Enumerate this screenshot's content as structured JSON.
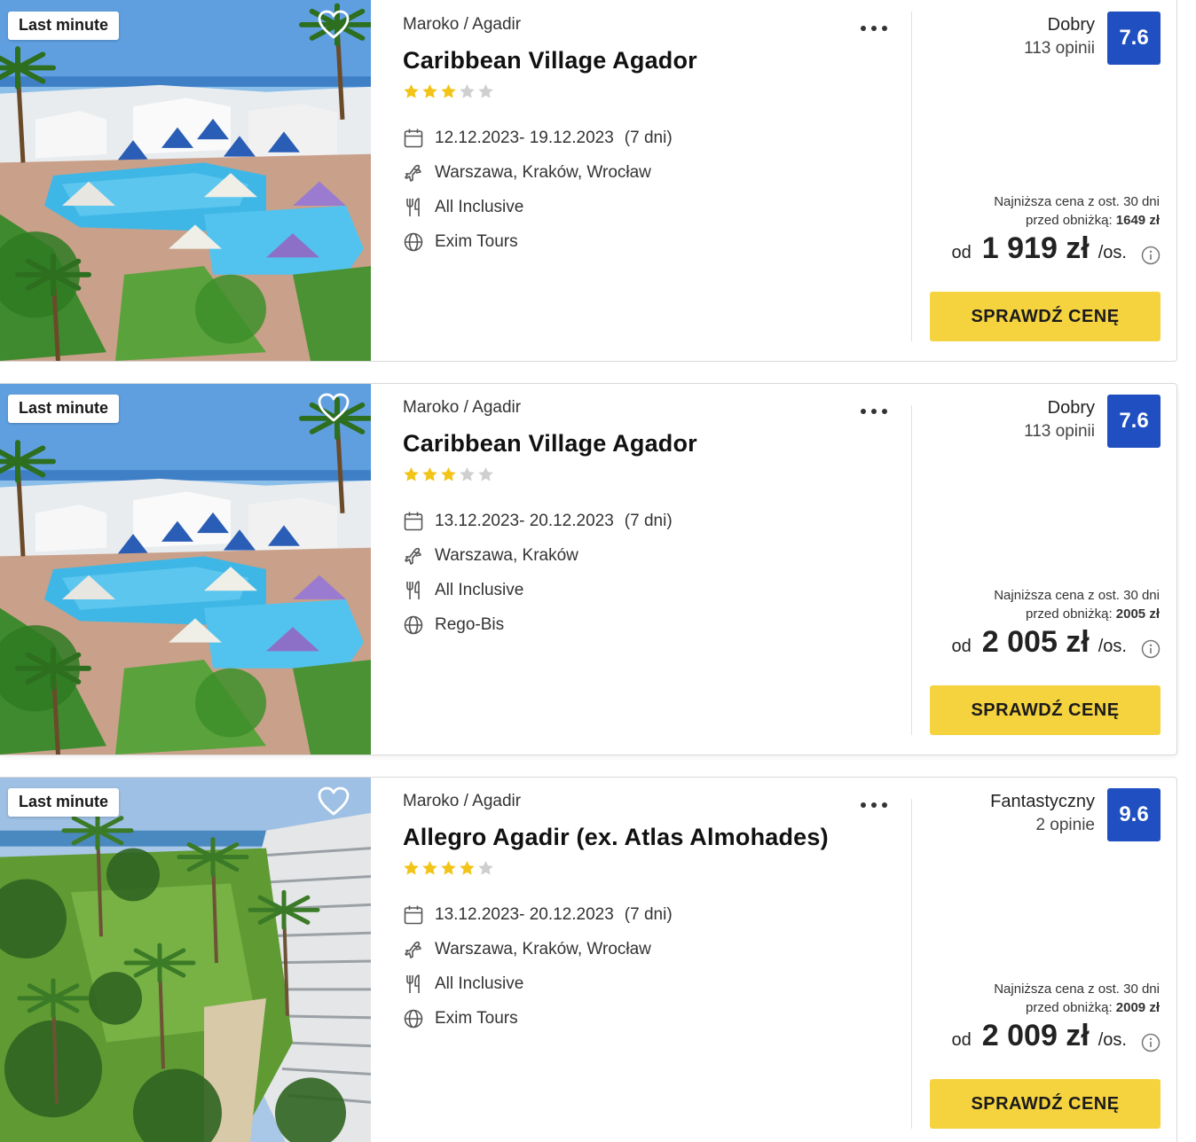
{
  "offers": [
    {
      "badge": "Last minute",
      "location": "Maroko / Agadir",
      "name": "Caribbean Village Agador",
      "stars": 3,
      "dates": "12.12.2023- 19.12.2023",
      "duration": "(7 dni)",
      "departures": "Warszawa, Kraków, Wrocław",
      "board": "All Inclusive",
      "operator": "Exim Tours",
      "rating_label": "Dobry",
      "reviews": "113 opinii",
      "score": "7.6",
      "lowest_line1": "Najniższa cena z ost. 30 dni",
      "lowest_line2": "przed obniżką:",
      "lowest_value": "1649 zł",
      "from": "od",
      "price": "1 919 zł",
      "per": "/os.",
      "cta": "SPRAWDŹ CENĘ"
    },
    {
      "badge": "Last minute",
      "location": "Maroko / Agadir",
      "name": "Caribbean Village Agador",
      "stars": 3,
      "dates": "13.12.2023- 20.12.2023",
      "duration": "(7 dni)",
      "departures": "Warszawa, Kraków",
      "board": "All Inclusive",
      "operator": "Rego-Bis",
      "rating_label": "Dobry",
      "reviews": "113 opinii",
      "score": "7.6",
      "lowest_line1": "Najniższa cena z ost. 30 dni",
      "lowest_line2": "przed obniżką:",
      "lowest_value": "2005 zł",
      "from": "od",
      "price": "2 005 zł",
      "per": "/os.",
      "cta": "SPRAWDŹ CENĘ"
    },
    {
      "badge": "Last minute",
      "location": "Maroko / Agadir",
      "name": "Allegro Agadir (ex. Atlas Almohades)",
      "stars": 4,
      "dates": "13.12.2023- 20.12.2023",
      "duration": "(7 dni)",
      "departures": "Warszawa, Kraków, Wrocław",
      "board": "All Inclusive",
      "operator": "Exim Tours",
      "rating_label": "Fantastyczny",
      "reviews": "2 opinie",
      "score": "9.6",
      "lowest_line1": "Najniższa cena z ost. 30 dni",
      "lowest_line2": "przed obniżką:",
      "lowest_value": "2009 zł",
      "from": "od",
      "price": "2 009 zł",
      "per": "/os.",
      "cta": "SPRAWDŹ CENĘ"
    }
  ],
  "colors": {
    "score_bg": "#1f4fc0",
    "cta_bg": "#f5d33f",
    "star_filled": "#f2c418",
    "star_empty": "#cfcfcf"
  },
  "icons": {
    "favorite": "heart-icon",
    "more": "more-dots-icon",
    "dates": "calendar-icon",
    "departures": "plane-icon",
    "board": "cutlery-icon",
    "operator": "globe-icon",
    "info": "info-icon"
  }
}
